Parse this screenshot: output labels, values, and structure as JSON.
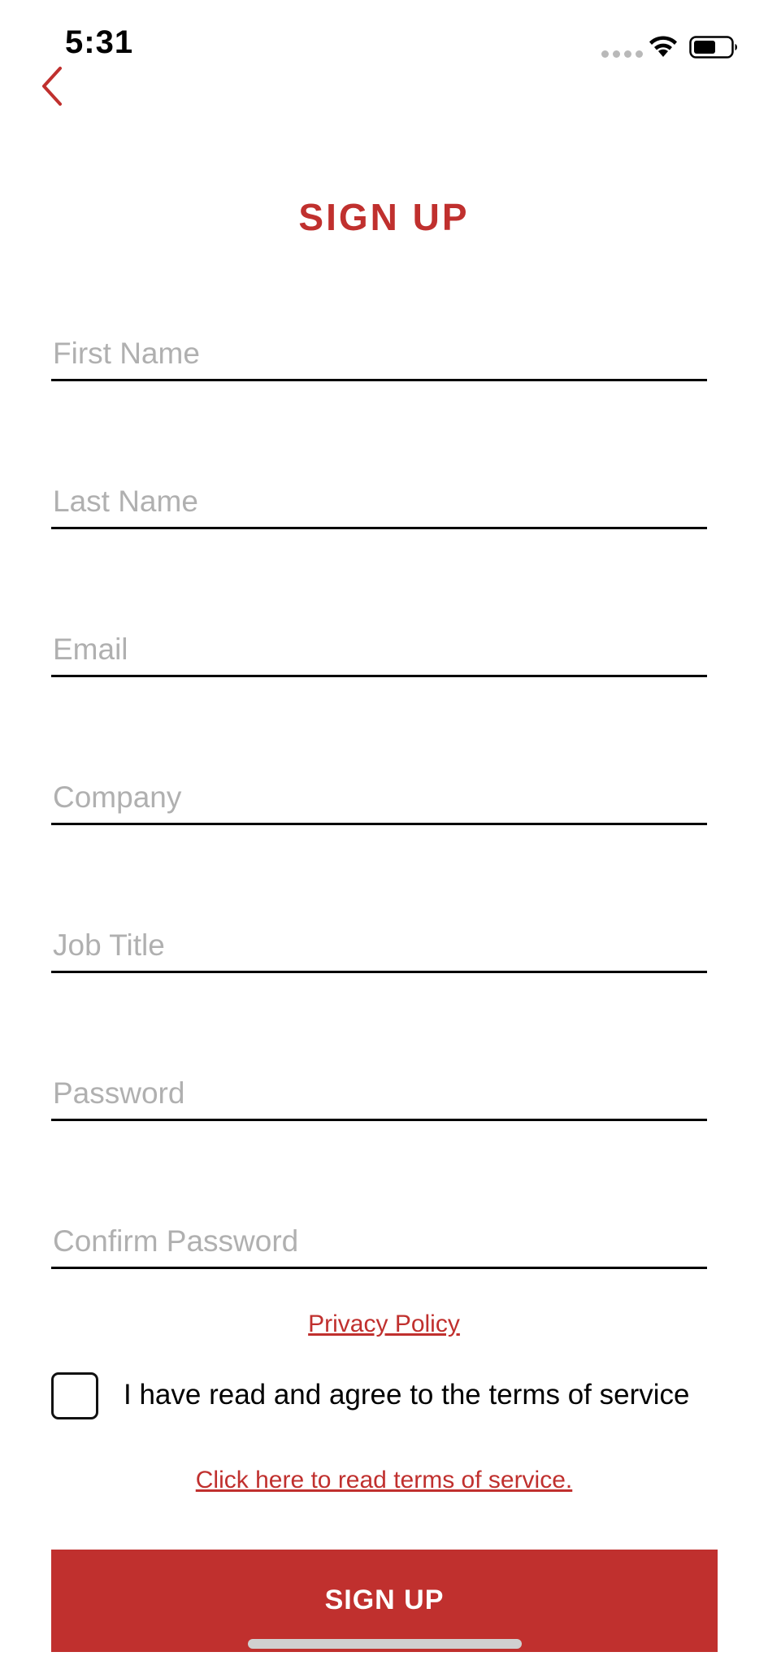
{
  "status_bar": {
    "time": "5:31"
  },
  "icons": {
    "back": "chevron-left-icon",
    "wifi": "wifi-icon",
    "battery": "battery-icon",
    "signal": "cellular-signal-icon"
  },
  "colors": {
    "accent": "#c0302e",
    "placeholder": "#b0b0b0",
    "underline": "#000000"
  },
  "title": "SIGN UP",
  "form": {
    "first_name": {
      "placeholder": "First Name",
      "value": ""
    },
    "last_name": {
      "placeholder": "Last Name",
      "value": ""
    },
    "email": {
      "placeholder": "Email",
      "value": ""
    },
    "company": {
      "placeholder": "Company",
      "value": ""
    },
    "job_title": {
      "placeholder": "Job Title",
      "value": ""
    },
    "password": {
      "placeholder": "Password",
      "value": ""
    },
    "confirm_password": {
      "placeholder": "Confirm Password",
      "value": ""
    }
  },
  "privacy_link": "Privacy Policy",
  "terms": {
    "checked": false,
    "label": "I have read and agree to the terms of service",
    "link": "Click here to read terms of service."
  },
  "submit_label": "SIGN UP"
}
